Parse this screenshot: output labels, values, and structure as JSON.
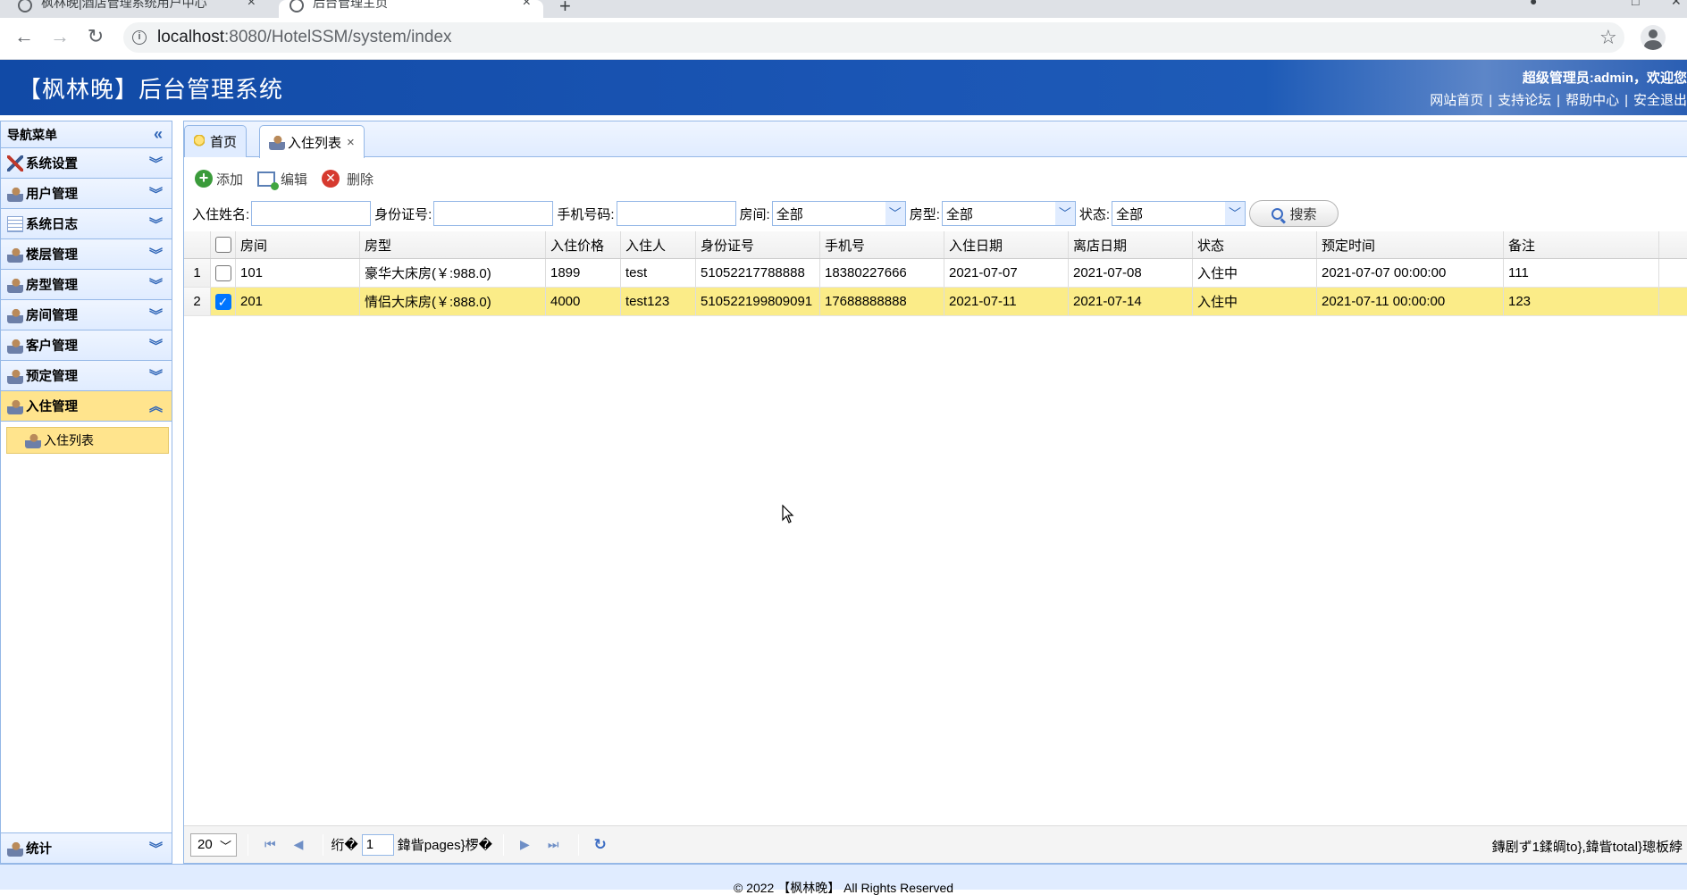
{
  "browser": {
    "tabs": [
      {
        "title": "枫林晚|酒店管理系统用户中心"
      },
      {
        "title": "后台管理主页"
      }
    ],
    "url_host": "localhost",
    "url_path": ":8080/HotelSSM/system/index"
  },
  "header": {
    "title": "【枫林晚】后台管理系统",
    "user": "超级管理员:admin，欢迎您",
    "links": [
      "网站首页",
      "支持论坛",
      "帮助中心",
      "安全退出"
    ]
  },
  "sidebar": {
    "title": "导航菜单",
    "items": [
      {
        "label": "系统设置",
        "icon": "tools-icon"
      },
      {
        "label": "用户管理",
        "icon": "user-icon"
      },
      {
        "label": "系统日志",
        "icon": "log-icon"
      },
      {
        "label": "楼层管理",
        "icon": "user-icon"
      },
      {
        "label": "房型管理",
        "icon": "user-icon"
      },
      {
        "label": "房间管理",
        "icon": "user-icon"
      },
      {
        "label": "客户管理",
        "icon": "user-icon"
      },
      {
        "label": "预定管理",
        "icon": "user-icon"
      },
      {
        "label": "入住管理",
        "icon": "user-icon"
      }
    ],
    "active_sub": "入住列表",
    "bottom": "统计"
  },
  "page_tabs": [
    {
      "label": "首页"
    },
    {
      "label": "入住列表"
    }
  ],
  "toolbar": {
    "add": "添加",
    "edit": "编辑",
    "delete": "删除"
  },
  "search": {
    "name_label": "入住姓名:",
    "id_label": "身份证号:",
    "phone_label": "手机号码:",
    "room_label": "房间:",
    "room_value": "全部",
    "type_label": "房型:",
    "type_value": "全部",
    "status_label": "状态:",
    "status_value": "全部",
    "button": "搜索"
  },
  "table": {
    "columns": [
      "房间",
      "房型",
      "入住价格",
      "入住人",
      "身份证号",
      "手机号",
      "入住日期",
      "离店日期",
      "状态",
      "预定时间",
      "备注"
    ],
    "rows": [
      {
        "num": "1",
        "checked": false,
        "cells": [
          "101",
          "豪华大床房(￥:988.0)",
          "1899",
          "test",
          "51052217788888",
          "18380227666",
          "2021-07-07",
          "2021-07-08",
          "入住中",
          "2021-07-07 00:00:00",
          "111"
        ]
      },
      {
        "num": "2",
        "checked": true,
        "cells": [
          "201",
          "情侣大床房(￥:888.0)",
          "4000",
          "test123",
          "510522199809091",
          "17688888888",
          "2021-07-11",
          "2021-07-14",
          "入住中",
          "2021-07-11 00:00:00",
          "123"
        ]
      }
    ]
  },
  "pager": {
    "page_size": "20",
    "before_input": "绗�",
    "page": "1",
    "after_input": "鍏眥pages}椤�",
    "info": "鏄剧ず1鍒皗to},鍏眥total}璁板綍"
  },
  "footer": "© 2022 【枫林晚】 All Rights Reserved"
}
